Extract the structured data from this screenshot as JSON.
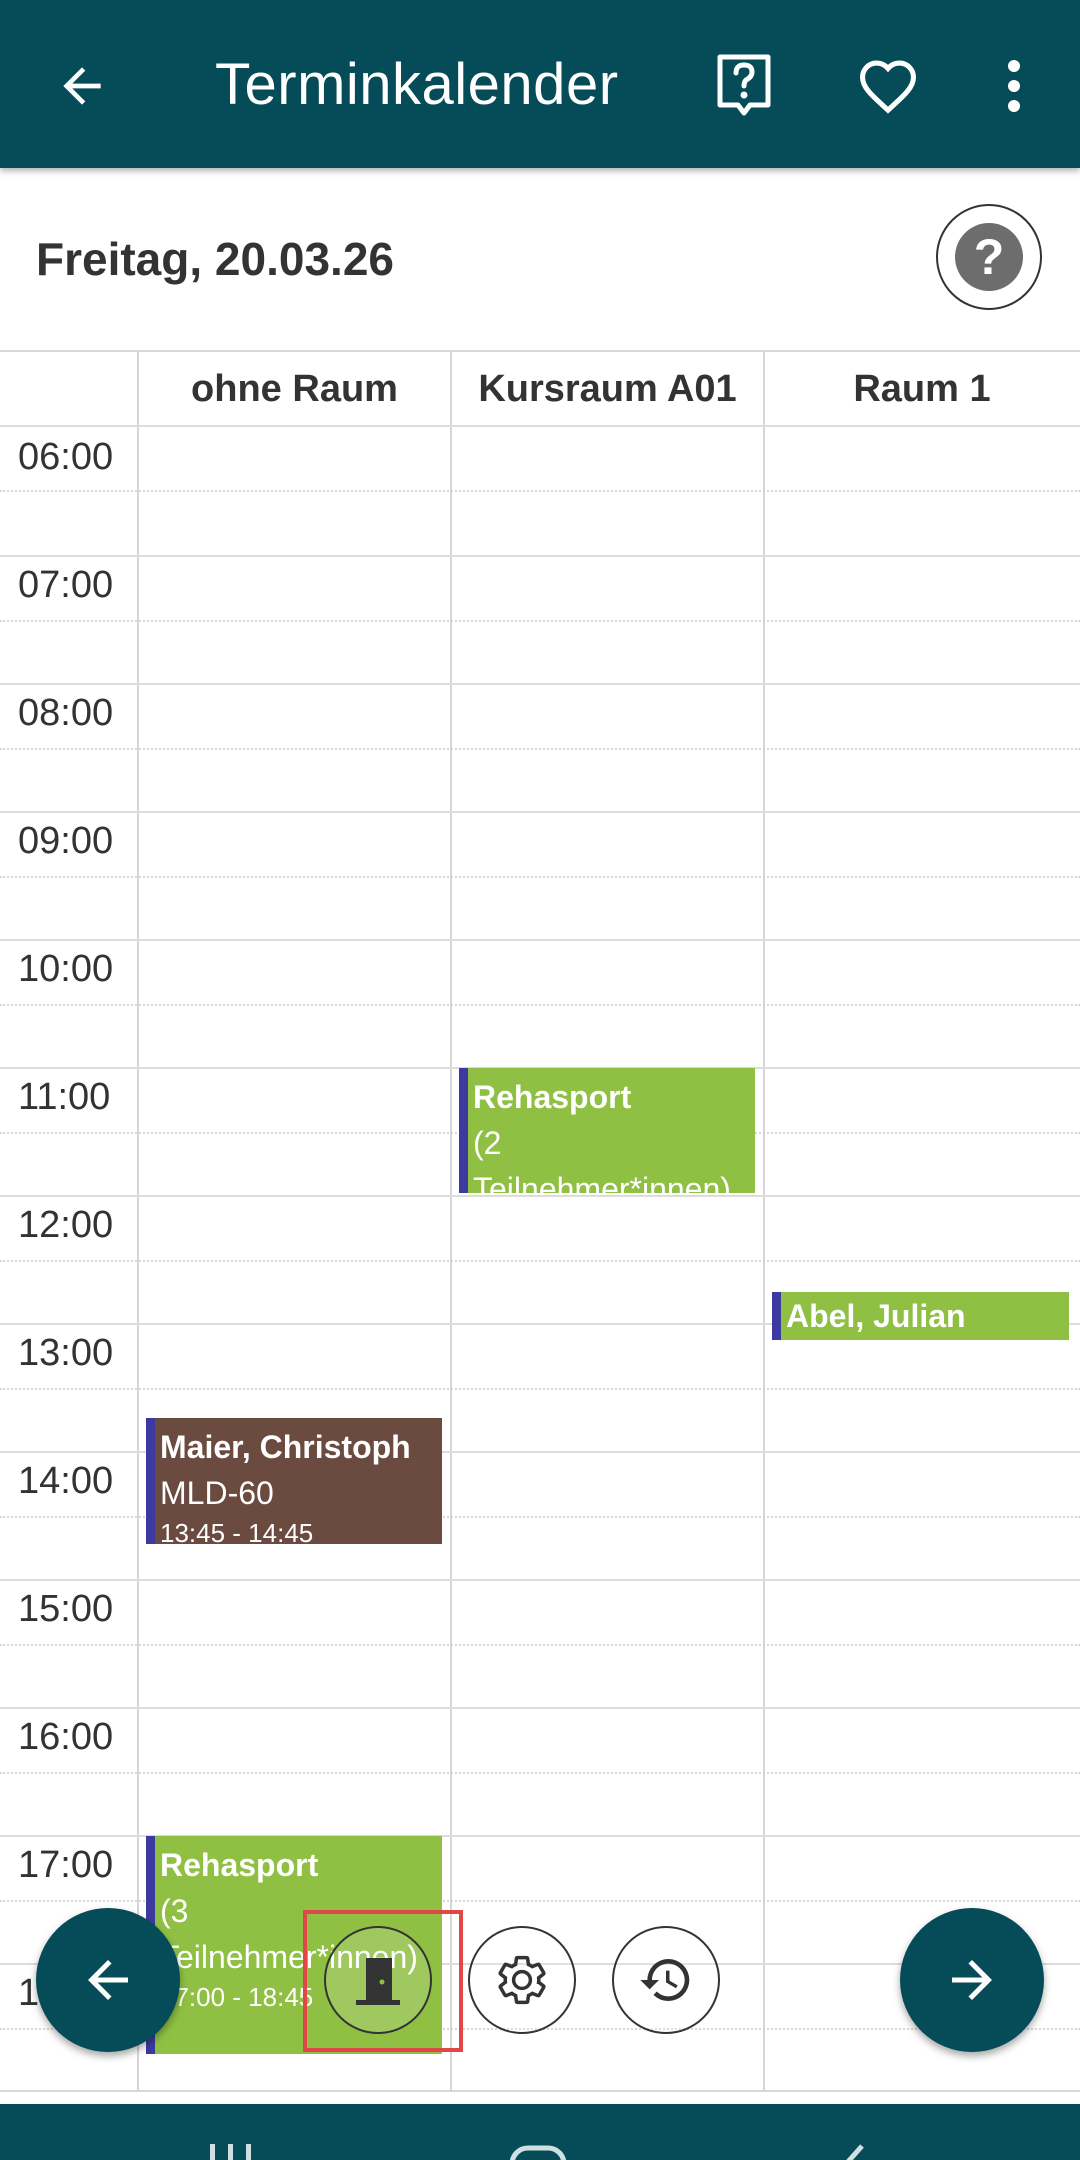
{
  "app_bar": {
    "title": "Terminkalender",
    "icons": [
      "arrow-back-icon",
      "help-chat-icon",
      "heart-icon",
      "more-vert-icon"
    ],
    "background": "#054b58"
  },
  "date_bar": {
    "date": "Freitag, 20.03.26",
    "help_symbol": "?"
  },
  "columns": [
    "ohne Raum",
    "Kursraum A01",
    "Raum 1"
  ],
  "times": [
    "06:00",
    "07:00",
    "08:00",
    "09:00",
    "10:00",
    "11:00",
    "12:00",
    "13:00",
    "14:00",
    "15:00",
    "16:00",
    "17:00",
    "1"
  ],
  "events": [
    {
      "title": "Rehasport",
      "line2": "(2",
      "line3": "Teilnehmer*innen)",
      "column": "Kursraum A01",
      "color": "#8fc043"
    },
    {
      "title": "Abel, Julian",
      "column": "Raum 1",
      "color": "#8fc043"
    },
    {
      "title": "Maier, Christoph",
      "line2": "MLD-60",
      "line3": "13:45 - 14:45",
      "column": "ohne Raum",
      "color": "#6b4a40"
    },
    {
      "title": "Rehasport",
      "line2": "(3",
      "line3": "Teilnehmer*innen)",
      "line4": "17:00 - 18:45",
      "column": "ohne Raum",
      "color": "#8fc043"
    }
  ],
  "bottom_controls": {
    "prev_icon": "arrow-back-icon",
    "next_icon": "arrow-forward-icon",
    "tools": [
      "door-icon",
      "settings-gear-icon",
      "history-clock-icon"
    ]
  }
}
